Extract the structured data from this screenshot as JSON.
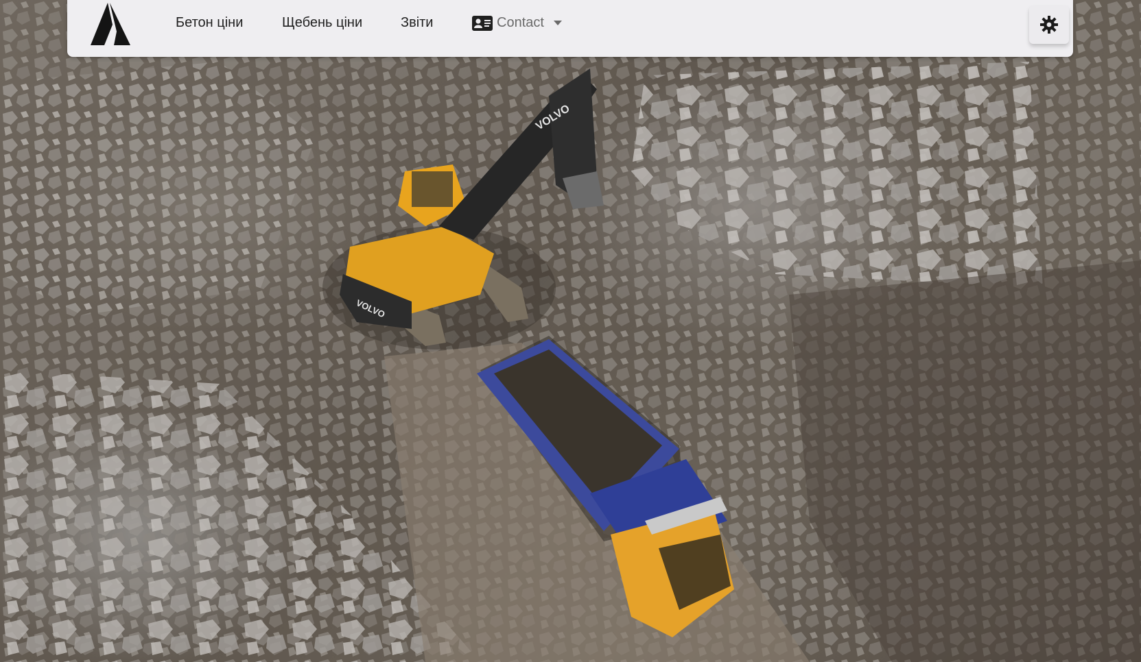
{
  "nav": {
    "items": [
      {
        "label": "Бетон ціни"
      },
      {
        "label": "Щебень ціни"
      },
      {
        "label": "Звіти"
      }
    ],
    "contact": {
      "label": "Contact"
    }
  },
  "hero": {
    "excavator_brand": "VOLVO",
    "excavator_brand_rear": "VOLVO"
  },
  "icons": {
    "logo": "logo-mountain-icon",
    "contact": "contact-card-icon",
    "theme": "gear-icon",
    "caret": "chevron-down-icon"
  }
}
